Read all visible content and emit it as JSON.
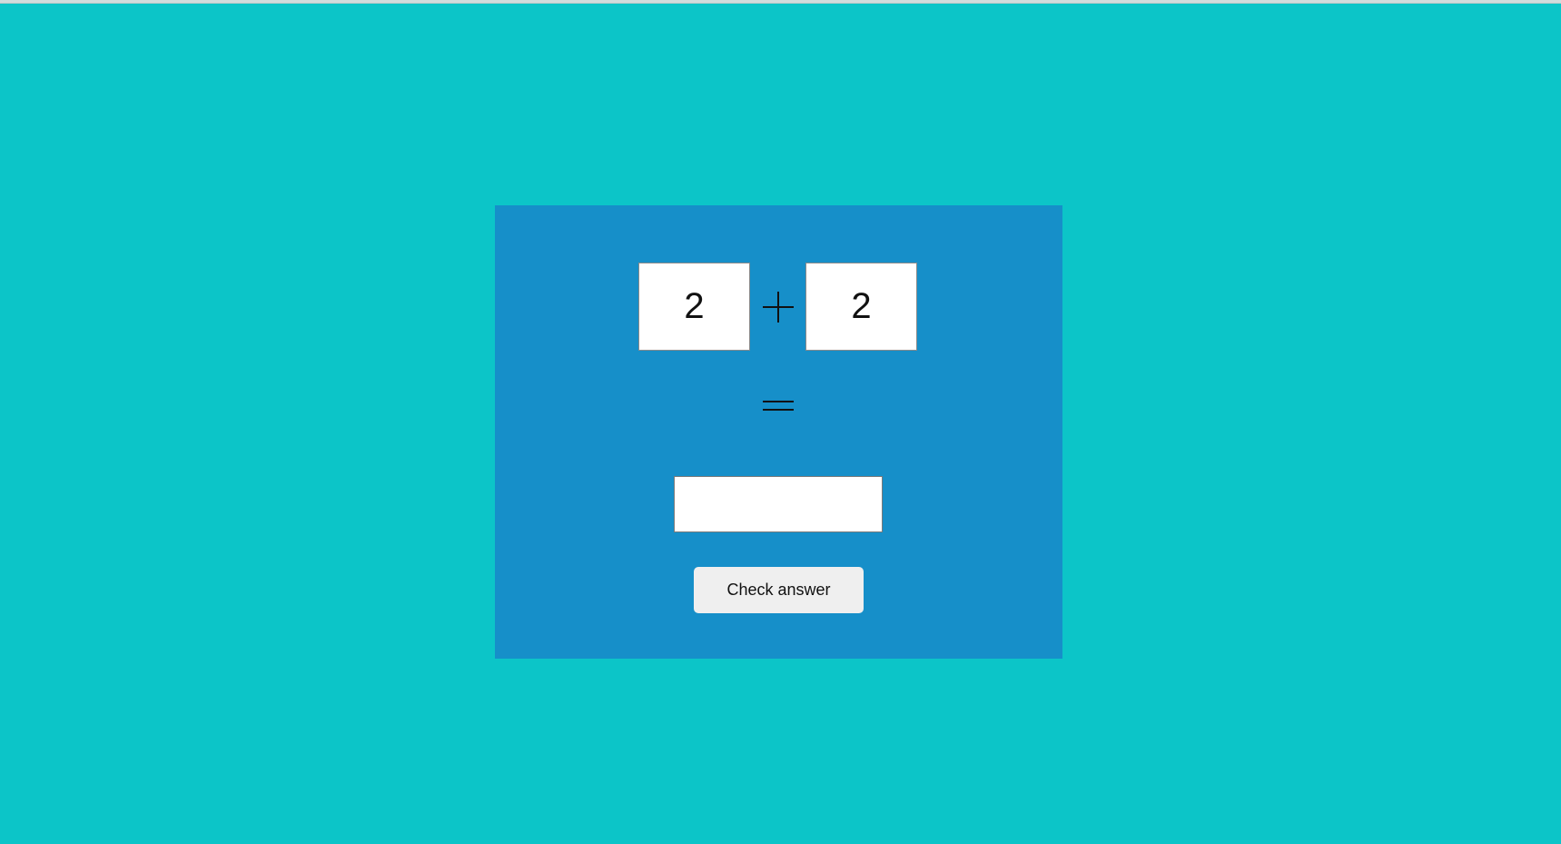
{
  "colors": {
    "page_background": "#0cc5c8",
    "panel_background": "#168fc9",
    "box_background": "#ffffff",
    "button_background": "#efefef"
  },
  "equation": {
    "operand_a": "2",
    "operator_icon": "plus-icon",
    "operand_b": "2",
    "result_icon": "equals-icon"
  },
  "answer": {
    "value": "",
    "placeholder": ""
  },
  "check_button": {
    "label": "Check answer"
  }
}
